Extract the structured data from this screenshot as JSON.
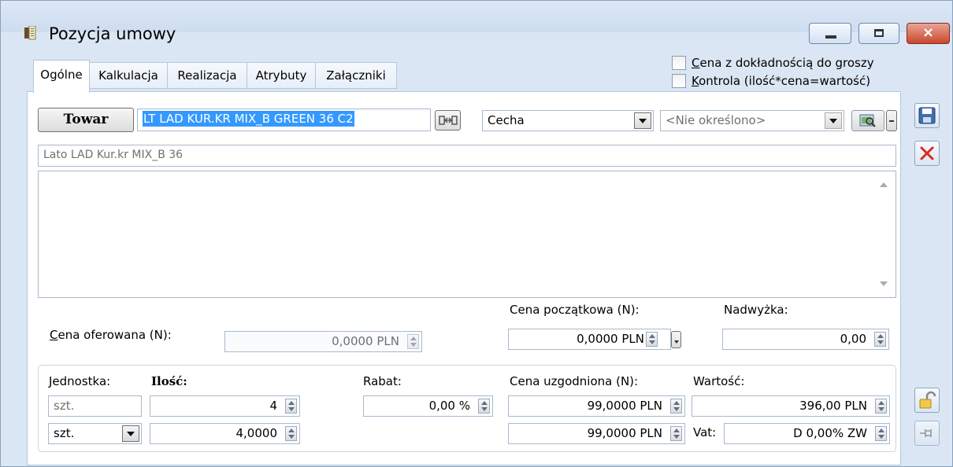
{
  "window": {
    "title": "Pozycja umowy",
    "close_symbol": "×"
  },
  "tabs": [
    {
      "label": "Ogólne"
    },
    {
      "label": "Kalkulacja"
    },
    {
      "label": "Realizacja"
    },
    {
      "label": "Atrybuty"
    },
    {
      "label": "Załączniki"
    }
  ],
  "options": {
    "cena_grosze": "Cena z dokładnością do groszy",
    "kontrola": "Kontrola (ilość*cena=wartość)"
  },
  "product": {
    "button_label": "Towar",
    "code": "LT LAD KUR.KR MIX_B GREEN 36 C2",
    "name": "Lato LAD Kur.kr MIX_B 36",
    "feature_select": "Cecha",
    "feature_value": "<Nie określono>"
  },
  "prices": {
    "cena_oferowana_label": "Cena oferowana (N):",
    "cena_oferowana_value": "0,0000 PLN",
    "cena_poczatkowa_label": "Cena początkowa (N):",
    "cena_poczatkowa_value": "0,0000 PLN",
    "nadwyzka_label": "Nadwyżka:",
    "nadwyzka_value": "0,00"
  },
  "quantity": {
    "jednostka_label": "Jednostka:",
    "ilosc_label": "Ilość:",
    "rabat_label": "Rabat:",
    "cena_uzgodniona_label": "Cena uzgodniona (N):",
    "wartosc_label": "Wartość:",
    "jednostka_display": "szt.",
    "ilosc_value": "4",
    "rabat_value": "0,00 %",
    "cena_uzgodniona_value": "99,0000 PLN",
    "wartosc_value": "396,00 PLN",
    "jednostka_select": "szt.",
    "ilosc_value2": "4,0000",
    "cena_uzgodniona_value2": "99,0000 PLN",
    "vat_label": "Vat:",
    "vat_value": "D 0,00% ZW"
  },
  "icons": [
    "app-icon",
    "save-icon",
    "delete-icon",
    "lock-icon",
    "pin-icon",
    "link-icon",
    "search-icon"
  ],
  "colors": {
    "accent": "#3399ff",
    "delete": "#d92b1e",
    "selection": "#3399ff"
  }
}
